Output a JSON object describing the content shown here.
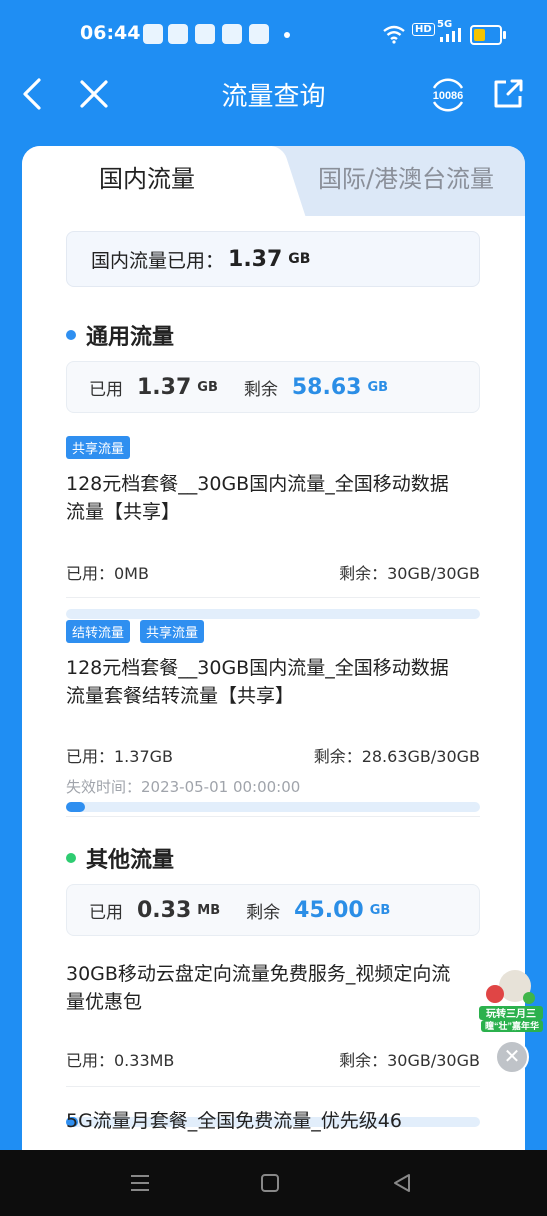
{
  "status_bar": {
    "time": "06:44",
    "network": "5G",
    "hd": "HD",
    "battery_color": "#f5c400"
  },
  "header": {
    "title": "流量查询",
    "service_number": "10086",
    "icons": [
      "back-chevron-icon",
      "close-icon",
      "service-10086-icon",
      "share-icon"
    ]
  },
  "tabs": {
    "domestic": "国内流量",
    "international": "国际/港澳台流量"
  },
  "summary": {
    "label": "国内流量已用：",
    "value": "1.37",
    "unit": "GB"
  },
  "general": {
    "title": "通用流量",
    "used_label": "已用",
    "used_value": "1.37",
    "used_unit": "GB",
    "remain_label": "剩余",
    "remain_value": "58.63",
    "remain_unit": "GB",
    "bullet_color": "#2f8ff0",
    "packages": [
      {
        "tags": [
          "共享流量"
        ],
        "name_line1": "128元档套餐__30GB国内流量_全国移动数据",
        "name_line2": "流量【共享】",
        "used": "已用：0MB",
        "remain": "剩余：30GB/30GB",
        "fill_fraction": 0.0
      },
      {
        "tags": [
          "结转流量",
          "共享流量"
        ],
        "name_line1": "128元档套餐__30GB国内流量_全国移动数据",
        "name_line2": "流量套餐结转流量【共享】",
        "used": "已用：1.37GB",
        "remain": "剩余：28.63GB/30GB",
        "expire": "失效时间：2023-05-01 00:00:00",
        "fill_fraction": 0.046
      }
    ]
  },
  "other": {
    "title": "其他流量",
    "used_label": "已用",
    "used_value": "0.33",
    "used_unit": "MB",
    "remain_label": "剩余",
    "remain_value": "45.00",
    "remain_unit": "GB",
    "bullet_color": "#2ecc71",
    "packages": [
      {
        "name_line1": "30GB移动云盘定向流量免费服务_视频定向流",
        "name_line2": "量优惠包",
        "used": "已用：0.33MB",
        "remain": "剩余：30GB/30GB",
        "fill_fraction": 0.01
      },
      {
        "name_line1": "5G流量月套餐_全国免费流量_优先级46"
      }
    ]
  },
  "promo": {
    "line1": "玩转三月三",
    "line2": "瞳“壮”嘉年华"
  },
  "nav": {
    "icons": [
      "menu-icon",
      "home-square-icon",
      "back-triangle-icon"
    ]
  }
}
